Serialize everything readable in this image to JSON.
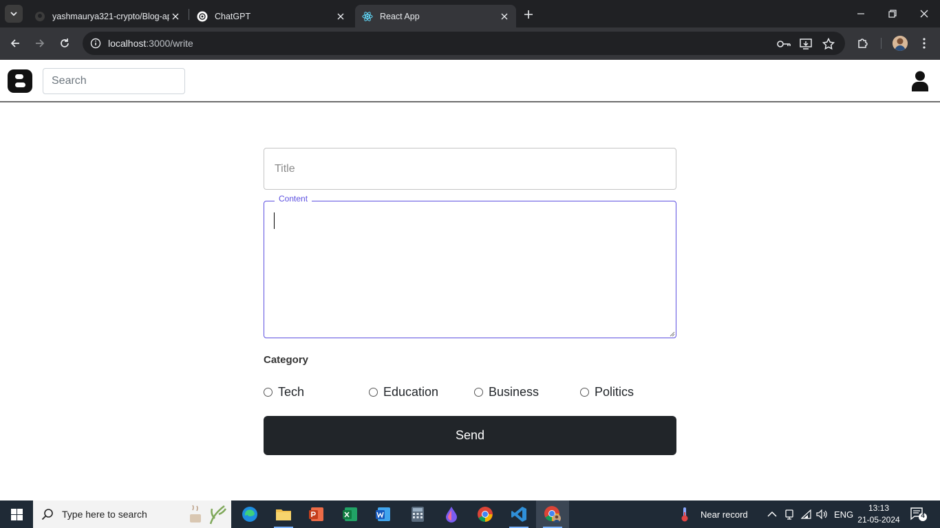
{
  "browser": {
    "tabs": [
      {
        "title": "yashmaurya321-crypto/Blog-ap",
        "favicon": "github-icon"
      },
      {
        "title": "ChatGPT",
        "favicon": "chatgpt-icon"
      },
      {
        "title": "React App",
        "favicon": "react-icon",
        "active": true
      }
    ],
    "url_host": "localhost",
    "url_path": ":3000/write"
  },
  "header": {
    "search_placeholder": "Search"
  },
  "form": {
    "title_placeholder": "Title",
    "content_label": "Content",
    "category_label": "Category",
    "categories": [
      "Tech",
      "Education",
      "Business",
      "Politics"
    ],
    "send_label": "Send"
  },
  "taskbar": {
    "search_text": "Type here to search",
    "weather_text": "Near record",
    "language": "ENG",
    "time": "13:13",
    "date": "21-05-2024",
    "notifications": "4"
  },
  "colors": {
    "accent": "#5b4fe0",
    "button": "#212529"
  }
}
